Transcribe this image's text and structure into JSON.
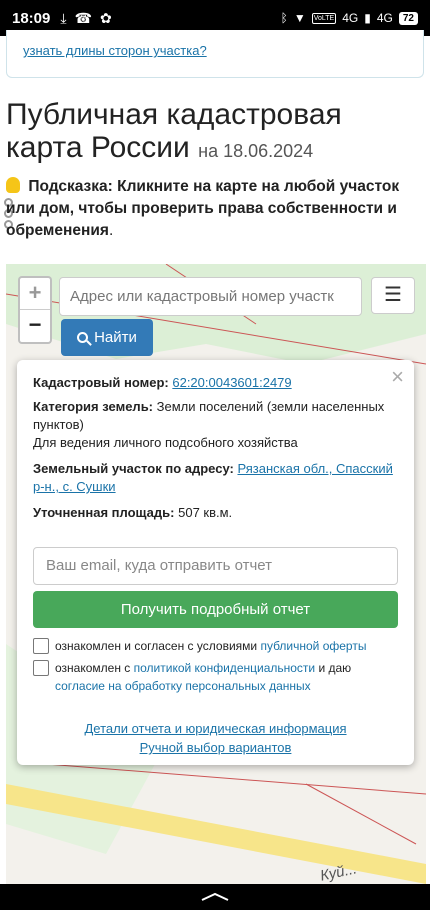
{
  "status": {
    "time": "18:09",
    "net_badge_1": "VoLTE",
    "net_badge_2": "4G",
    "net_badge_3": "4G",
    "battery": "72"
  },
  "prev_link": "узнать длины сторон участка?",
  "header": {
    "title": "Публичная кадастровая карта России",
    "date": "на 18.06.2024"
  },
  "hint": {
    "label": "Подсказка:",
    "text1": "Кликните на карте на любой участок или дом, чтобы",
    "bold": "проверить права собственности и обременения",
    "end": "."
  },
  "map": {
    "zoom_in": "+",
    "zoom_out": "−",
    "search_placeholder": "Адрес или кадастровый номер участк",
    "menu_icon": "☰",
    "find_label": "Найти",
    "road_label": "Куй..."
  },
  "popup": {
    "close": "×",
    "cad_label": "Кадастровый номер:",
    "cad_value": "62:20:0043601:2479",
    "cat_label": "Категория земель:",
    "cat_value": "Земли поселений (земли населенных пунктов)",
    "usage": "Для ведения личного подсобного хозяйства",
    "addr_label": "Земельный участок по адресу:",
    "addr_value": "Рязанская обл., Спасский р-н., с. Сушки",
    "area_label": "Уточненная площадь:",
    "area_value": "507 кв.м.",
    "email_placeholder": "Ваш email, куда отправить отчет",
    "get_button": "Получить подробный отчет",
    "chk1_text": "ознакомлен и согласен с условиями",
    "chk1_link": "публичной оферты",
    "chk2_text": "ознакомлен с",
    "chk2_link1": "политикой конфиденциальности",
    "chk2_and": "и даю",
    "chk2_link2": "согласие на обработку персональных данных",
    "details_link": "Детали отчета и юридическая информация",
    "manual_link": "Ручной выбор вариантов"
  }
}
